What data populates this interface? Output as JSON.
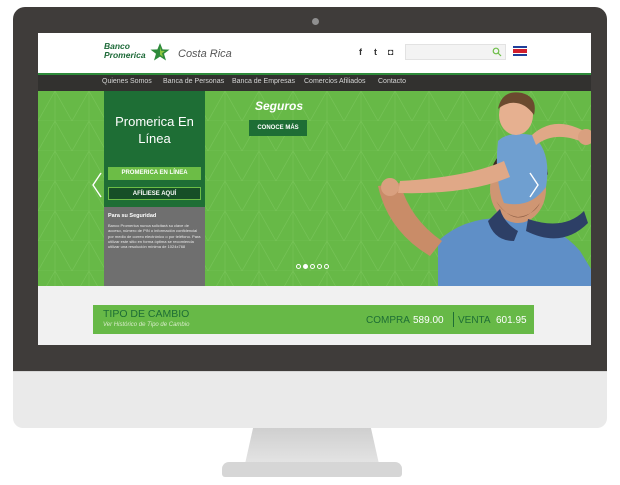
{
  "header": {
    "logo_line1": "Banco",
    "logo_line2": "Promerica",
    "country": "Costa Rica",
    "social": [
      "facebook-icon",
      "twitter-icon",
      "instagram-icon"
    ],
    "social_glyphs": [
      "f",
      "t",
      "◘"
    ],
    "search_placeholder": ""
  },
  "nav": {
    "items": [
      "Quienes Somos",
      "Banca de Personas",
      "Banca de Empresas",
      "Comercios Afiliados",
      "Contacto"
    ]
  },
  "hero": {
    "panel_title": "Promerica En Línea",
    "online_button": "PROMERICA EN LÍNEA",
    "join_button": "AFÍLIESE AQUÍ",
    "security_title": "Para su Seguridad",
    "security_text": "Banco Promerica nunca solicitará su clave de acceso, número de PIN o información confidencial por medio de correo electrónico o por teléfono. Para utilizar este sitio en forma óptima se recomienda utilizar una resolución mínima de 1024x768",
    "slide_title": "Seguros",
    "slide_button": "CONOCE MÁS",
    "slide_count": 5,
    "active_slide": 2
  },
  "exchange": {
    "title": "TIPO DE CAMBIO",
    "link": "Ver Histórico de Tipo de Cambio",
    "buy_label": "COMPRA",
    "buy_value": "589.00",
    "sell_label": "VENTA",
    "sell_value": "601.95"
  },
  "colors": {
    "brand_green": "#67b947",
    "dark_green": "#1e6e35",
    "nav_bg": "#32312f",
    "bezel": "#3f3c3a"
  }
}
